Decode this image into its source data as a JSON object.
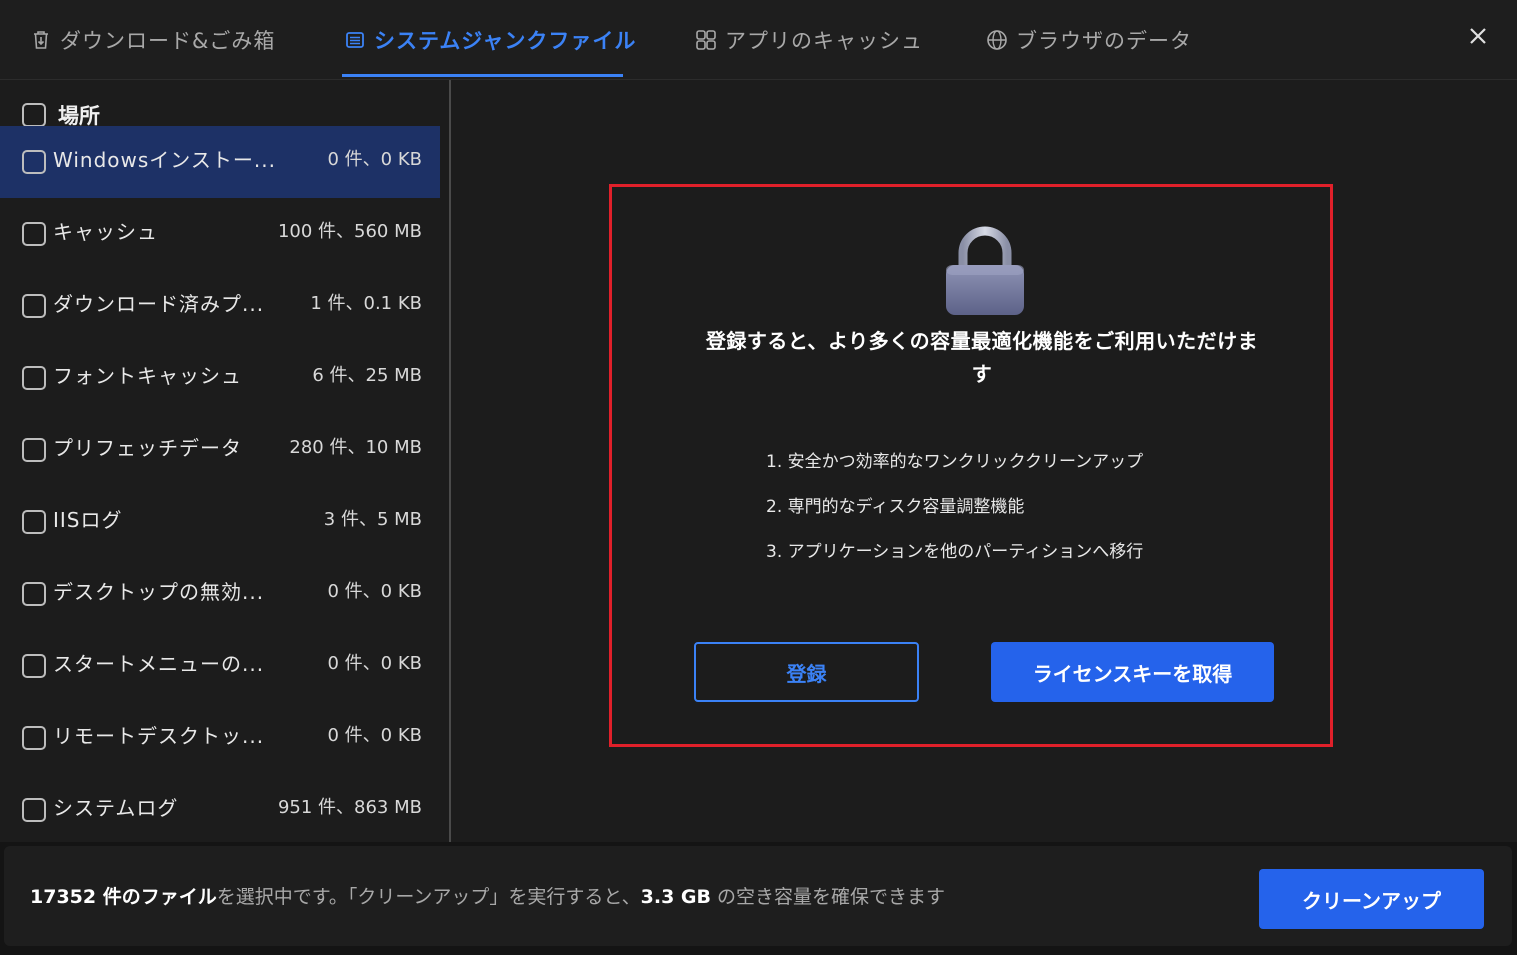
{
  "tabs": [
    {
      "label": "ダウンロード&ごみ箱",
      "icon": "trash-download-icon"
    },
    {
      "label": "システムジャンクファイル",
      "icon": "list-icon"
    },
    {
      "label": "アプリのキャッシュ",
      "icon": "apps-grid-icon"
    },
    {
      "label": "ブラウザのデータ",
      "icon": "globe-icon"
    }
  ],
  "sidebar": {
    "header": "場所",
    "items": [
      {
        "name": "Windowsインストー...",
        "size": "0 件、0 KB"
      },
      {
        "name": "キャッシュ",
        "size": "100 件、560 MB"
      },
      {
        "name": "ダウンロード済みプ...",
        "size": "1 件、0.1 KB"
      },
      {
        "name": "フォントキャッシュ",
        "size": "6 件、25 MB"
      },
      {
        "name": "プリフェッチデータ",
        "size": "280 件、10 MB"
      },
      {
        "name": "IISログ",
        "size": "3 件、5 MB"
      },
      {
        "name": "デスクトップの無効...",
        "size": "0 件、0 KB"
      },
      {
        "name": "スタートメニューの...",
        "size": "0 件、0 KB"
      },
      {
        "name": "リモートデスクトッ...",
        "size": "0 件、0 KB"
      },
      {
        "name": "システムログ",
        "size": "951 件、863 MB"
      }
    ]
  },
  "promo": {
    "title_line1": "登録すると、より多くの容量最適化機能をご利用いただけま",
    "title_line2": "す",
    "features": [
      "1. 安全かつ効率的なワンクリッククリーンアップ",
      "2. 専門的なディスク容量調整機能",
      "3. アプリケーションを他のパーティションへ移行"
    ],
    "register_label": "登録",
    "license_label": "ライセンスキーを取得"
  },
  "footer": {
    "count_bold": "17352 件のファイル",
    "text_mid": "を選択中です。「クリーンアップ」を実行すると、",
    "size_bold": "3.3 GB",
    "text_end": " の空き容量を確保できます",
    "cleanup_label": "クリーンアップ"
  },
  "colors": {
    "accent": "#3b82f6",
    "button": "#2563eb",
    "highlight": "#e0202a",
    "selected_row": "#1d3166"
  }
}
